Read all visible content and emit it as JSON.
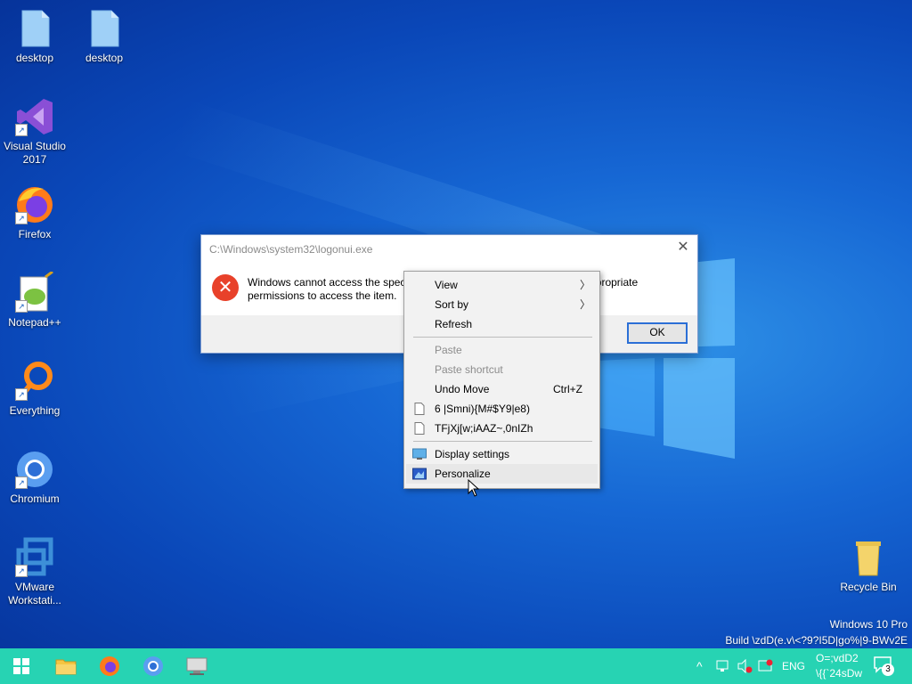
{
  "desktop": {
    "icons": [
      {
        "label": "desktop",
        "icon": "file-icon"
      },
      {
        "label": "desktop",
        "icon": "file-icon"
      },
      {
        "label": "Visual Studio 2017",
        "icon": "visual-studio-icon"
      },
      {
        "label": "Firefox",
        "icon": "firefox-icon"
      },
      {
        "label": "Notepad++",
        "icon": "notepadpp-icon"
      },
      {
        "label": "Everything",
        "icon": "everything-icon"
      },
      {
        "label": "Chromium",
        "icon": "chromium-icon"
      },
      {
        "label": "VMware Workstati...",
        "icon": "vmware-icon"
      },
      {
        "label": "Recycle Bin",
        "icon": "recycle-bin-icon"
      }
    ]
  },
  "dialog": {
    "title": "C:\\Windows\\system32\\logonui.exe",
    "close": "✕",
    "message_left": "Windows cannot access the spec",
    "message_right": "e the appropriate",
    "message_line2": "permissions to access the item.",
    "ok_label": "OK"
  },
  "context_menu": {
    "items": [
      {
        "label": "View",
        "submenu": true
      },
      {
        "label": "Sort by",
        "submenu": true
      },
      {
        "label": "Refresh"
      },
      {
        "label": "Paste",
        "disabled": true
      },
      {
        "label": "Paste shortcut",
        "disabled": true
      },
      {
        "label": "Undo Move",
        "shortcut": "Ctrl+Z"
      },
      {
        "label": "6 |Smni){M#$Y9|e8)",
        "icon": "document-icon"
      },
      {
        "label": "TFjXj[w;iAAZ~,0nIZh",
        "icon": "document-icon"
      },
      {
        "label": "Display settings",
        "icon": "display-icon"
      },
      {
        "label": "Personalize",
        "icon": "personalize-icon"
      }
    ]
  },
  "taskbar": {
    "lang": "ENG",
    "clock_line1": "O=;vdD2",
    "clock_line2": "\\{{`24sDw",
    "notif_count": "3",
    "accent": "#27d3b3"
  },
  "watermark": {
    "line1": "Windows 10 Pro",
    "line2": "Build \\zdD(e.v\\<?9?I5D|go%|9-BWv2E"
  }
}
